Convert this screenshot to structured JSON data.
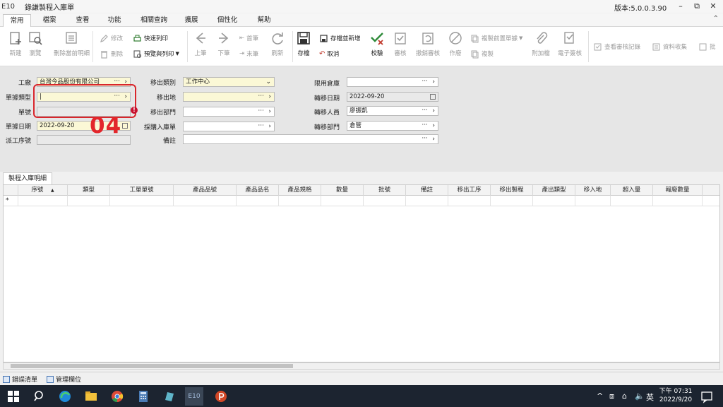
{
  "window": {
    "app_code": "E10",
    "title": "錄謙製程入庫單",
    "version": "版本:5.0.0.3.90",
    "min": "–",
    "max": "⧉",
    "close": "✕"
  },
  "ribbon_tabs": [
    "常用",
    "檔案",
    "查看",
    "功能",
    "相關查詢",
    "擴展",
    "個性化",
    "幫助"
  ],
  "toolbar": {
    "new": "新建",
    "browse": "瀏覽",
    "delete_detail": "刪除當前明細",
    "modify": "修改",
    "delete": "刪除",
    "quick_print": "快速列印",
    "preview_print": "預覽與列印",
    "prev": "上筆",
    "next": "下筆",
    "first": "首筆",
    "last": "末筆",
    "refresh": "刷新",
    "save": "存檔",
    "save_new": "存檔並新增",
    "cancel": "取消",
    "verify": "校驗",
    "approve": "審核",
    "unapprove": "撤銷審核",
    "void": "作廢",
    "copy_prev": "複製前置單據",
    "copy": "複製",
    "attach": "附加檔",
    "esign": "電子簽核",
    "audit_log": "查看審核記錄",
    "collect": "資料收集",
    "more": "批"
  },
  "form": {
    "plant_label": "工廠",
    "plant_value": "台灣今品股份有限公司",
    "doctype_label": "單據類型",
    "doctype_value": "|",
    "docno_label": "單號",
    "docdate_label": "單據日期",
    "docdate_value": "2022-09-20",
    "wo_seq_label": "派工序號",
    "out_type_label": "移出類別",
    "out_type_value": "工作中心",
    "out_place_label": "移出地",
    "out_dept_label": "移出部門",
    "purchase_in_label": "採購入庫單",
    "remark_label": "備註",
    "limit_wh_label": "限用倉庫",
    "transfer_date_label": "轉移日期",
    "transfer_date_value": "2022-09-20",
    "transfer_person_label": "轉移人員",
    "transfer_person_value": "廖振凱",
    "transfer_dept_label": "轉移部門",
    "transfer_dept_value": "倉管",
    "error_mark": "!",
    "step_annotation": "04"
  },
  "detail": {
    "tab_label": "製程入庫明細",
    "columns": [
      "序號",
      "類型",
      "工單單號",
      "產品品號",
      "產品品名",
      "產品規格",
      "數量",
      "批號",
      "備註",
      "移出工序",
      "移出製程",
      "產出類型",
      "移入地",
      "超入量",
      "報廢數量"
    ],
    "sort_indicator": "▲",
    "new_row_marker": "*"
  },
  "bottom_tabs": [
    "錯誤清單",
    "管理欄位"
  ],
  "taskbar": {
    "lang": "英",
    "time": "下午 07:31",
    "date": "2022/9/20"
  },
  "colors": {
    "required_field": "#fbf8d6",
    "highlight": "#d9262c",
    "taskbar": "#1c2430"
  }
}
